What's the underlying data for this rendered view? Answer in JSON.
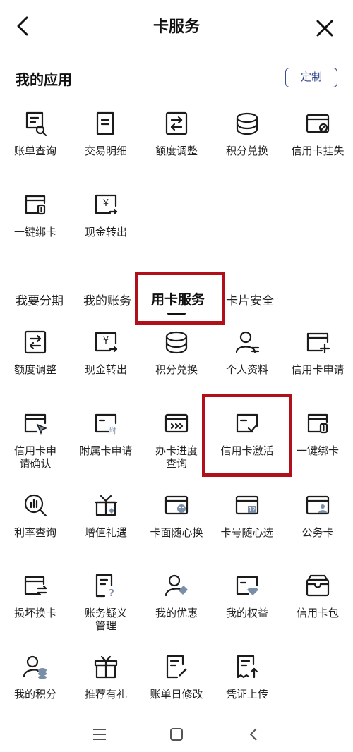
{
  "header": {
    "title": "卡服务",
    "back_icon": "chevron-left-icon",
    "close_icon": "close-icon"
  },
  "my_apps": {
    "title": "我的应用",
    "customize_label": "定制",
    "items": [
      {
        "label": "账单查询",
        "icon": "bill-search-icon"
      },
      {
        "label": "交易明细",
        "icon": "document-list-icon"
      },
      {
        "label": "额度调整",
        "icon": "swap-arrows-icon"
      },
      {
        "label": "积分兑换",
        "icon": "coin-stack-icon"
      },
      {
        "label": "信用卡挂失",
        "icon": "card-block-icon"
      },
      {
        "label": "一键绑卡",
        "icon": "card-link-icon"
      },
      {
        "label": "现金转出",
        "icon": "cash-transfer-icon"
      }
    ]
  },
  "tabs": {
    "items": [
      "我要分期",
      "我的账务",
      "用卡服务",
      "卡片安全"
    ],
    "active": "用卡服务"
  },
  "services": {
    "items": [
      {
        "label": "额度调整",
        "icon": "swap-arrows-icon"
      },
      {
        "label": "现金转出",
        "icon": "cash-transfer-icon"
      },
      {
        "label": "积分兑换",
        "icon": "coin-stack-icon"
      },
      {
        "label": "个人资料",
        "icon": "user-profile-icon"
      },
      {
        "label": "信用卡申请",
        "icon": "card-add-icon"
      },
      {
        "label": "信用卡申\n请确认",
        "icon": "card-cursor-icon"
      },
      {
        "label": "附属卡申请",
        "icon": "card-attach-icon"
      },
      {
        "label": "办卡进度\n查询",
        "icon": "card-progress-icon"
      },
      {
        "label": "信用卡激活",
        "icon": "card-check-icon"
      },
      {
        "label": "一键绑卡",
        "icon": "card-link-icon"
      },
      {
        "label": "利率查询",
        "icon": "rate-search-icon"
      },
      {
        "label": "增值礼遇",
        "icon": "gift-icon"
      },
      {
        "label": "卡面随心换",
        "icon": "card-palette-icon"
      },
      {
        "label": "卡号随心选",
        "icon": "card-number-icon"
      },
      {
        "label": "公务卡",
        "icon": "card-person-icon"
      },
      {
        "label": "损坏换卡",
        "icon": "card-exchange-icon"
      },
      {
        "label": "账务疑义\n管理",
        "icon": "doc-question-icon"
      },
      {
        "label": "我的优惠",
        "icon": "user-tag-icon"
      },
      {
        "label": "我的权益",
        "icon": "card-diamond-icon"
      },
      {
        "label": "信用卡包",
        "icon": "wallet-icon"
      },
      {
        "label": "我的积分",
        "icon": "user-coins-icon"
      },
      {
        "label": "推荐有礼",
        "icon": "gift-box-icon"
      },
      {
        "label": "账单日修改",
        "icon": "doc-edit-icon"
      },
      {
        "label": "凭证上传",
        "icon": "receipt-upload-icon"
      }
    ]
  },
  "navbar": {
    "menu_icon": "menu-icon",
    "home_icon": "home-square-icon",
    "back_icon": "back-triangle-icon"
  }
}
